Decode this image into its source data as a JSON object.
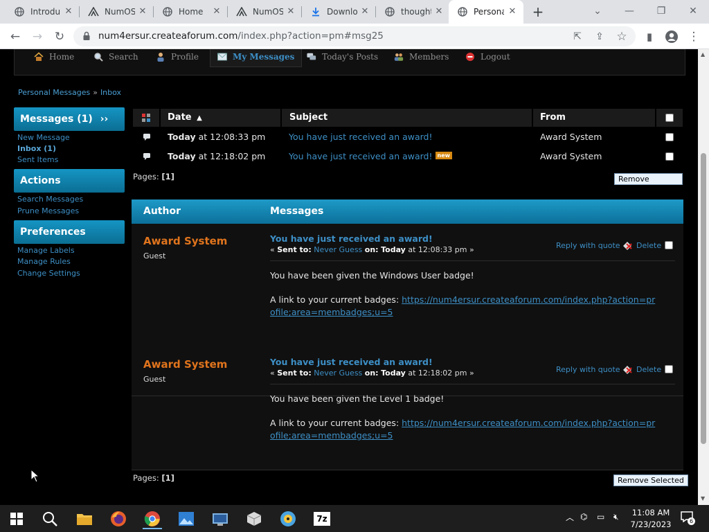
{
  "browser": {
    "tabs": [
      {
        "title": "Introdu",
        "icon": "globe-icon"
      },
      {
        "title": "NumOS",
        "icon": "numos-logo-icon"
      },
      {
        "title": "Home",
        "icon": "globe-icon"
      },
      {
        "title": "NumOS",
        "icon": "numos-logo-icon"
      },
      {
        "title": "Downlo",
        "icon": "download-icon"
      },
      {
        "title": "thought",
        "icon": "globe-icon"
      },
      {
        "title": "Persona",
        "icon": "globe-icon",
        "active": true
      }
    ],
    "url_host": "num4ersur.createaforum.com",
    "url_path": "/index.php?action=pm#msg25"
  },
  "forum": {
    "nav": [
      {
        "label": "Home",
        "icon": "home-icon"
      },
      {
        "label": "Search",
        "icon": "search-icon"
      },
      {
        "label": "Profile",
        "icon": "profile-icon"
      },
      {
        "label": "My Messages",
        "icon": "envelope-icon",
        "active": true
      },
      {
        "label": "Today's Posts",
        "icon": "posts-icon"
      },
      {
        "label": "Members",
        "icon": "members-icon"
      },
      {
        "label": "Logout",
        "icon": "logout-icon"
      }
    ],
    "breadcrumb": {
      "first": "Personal Messages",
      "separator": "»",
      "second": "Inbox"
    },
    "sidebar": {
      "messages_title": "Messages (1)",
      "messages_arrows": "››",
      "messages_links": [
        "New Message",
        "Inbox (1)",
        "Sent Items"
      ],
      "actions_title": "Actions",
      "actions_links": [
        "Search Messages",
        "Prune Messages"
      ],
      "preferences_title": "Preferences",
      "preferences_links": [
        "Manage Labels",
        "Manage Rules",
        "Change Settings"
      ]
    },
    "inbox": {
      "columns": {
        "date": "Date",
        "subject": "Subject",
        "from": "From"
      },
      "rows": [
        {
          "date_day": "Today",
          "date_rest": " at 12:08:33 pm",
          "subject": "You have just received an award!",
          "is_new": false,
          "from": "Award System"
        },
        {
          "date_day": "Today",
          "date_rest": " at 12:18:02 pm",
          "subject": "You have just received an award!",
          "is_new": true,
          "new_badge": "new",
          "from": "Award System"
        }
      ],
      "pages_label": "Pages: ",
      "pages_value": "[1]",
      "remove_selected": "Remove Selected"
    },
    "messages": {
      "header_author": "Author",
      "header_messages": "Messages",
      "items": [
        {
          "author": "Award System",
          "role": "Guest",
          "subject": "You have just received an award!",
          "meta_open": "« ",
          "sent_to_label": "Sent to:",
          "sent_to": "Never Guess",
          "on_label": "on:",
          "on_day": "Today",
          "on_time": " at 12:08:33 pm »",
          "reply": "Reply with quote",
          "delete": "Delete",
          "body_line1": "You have been given the Windows User badge!",
          "body_line2_prefix": "A link to your current badges: ",
          "body_link": "https://num4ersur.createaforum.com/index.php?action=profile;area=membadges;u=5"
        },
        {
          "author": "Award System",
          "role": "Guest",
          "subject": "You have just received an award!",
          "meta_open": "« ",
          "sent_to_label": "Sent to:",
          "sent_to": "Never Guess",
          "on_label": "on:",
          "on_day": "Today",
          "on_time": " at 12:18:02 pm »",
          "reply": "Reply with quote",
          "delete": "Delete",
          "body_line1": "You have been given the Level 1 badge!",
          "body_line2_prefix": "A link to your current badges: ",
          "body_link": "https://num4ersur.createaforum.com/index.php?action=profile;area=membadges;u=5"
        }
      ],
      "pages_label": "Pages: ",
      "pages_value": "[1]",
      "remove_selected": "Remove Selected"
    }
  },
  "taskbar": {
    "apps": [
      "windows-start",
      "search",
      "file-explorer",
      "firefox",
      "chrome",
      "photos",
      "control-panel",
      "package",
      "media",
      "7zip"
    ],
    "time": "11:08 AM",
    "date": "7/23/2023",
    "notification_count": "6"
  },
  "colors": {
    "accent": "#0c7099",
    "link": "#3d8fc6",
    "author": "#e0741d",
    "new_badge": "#d88a12"
  }
}
